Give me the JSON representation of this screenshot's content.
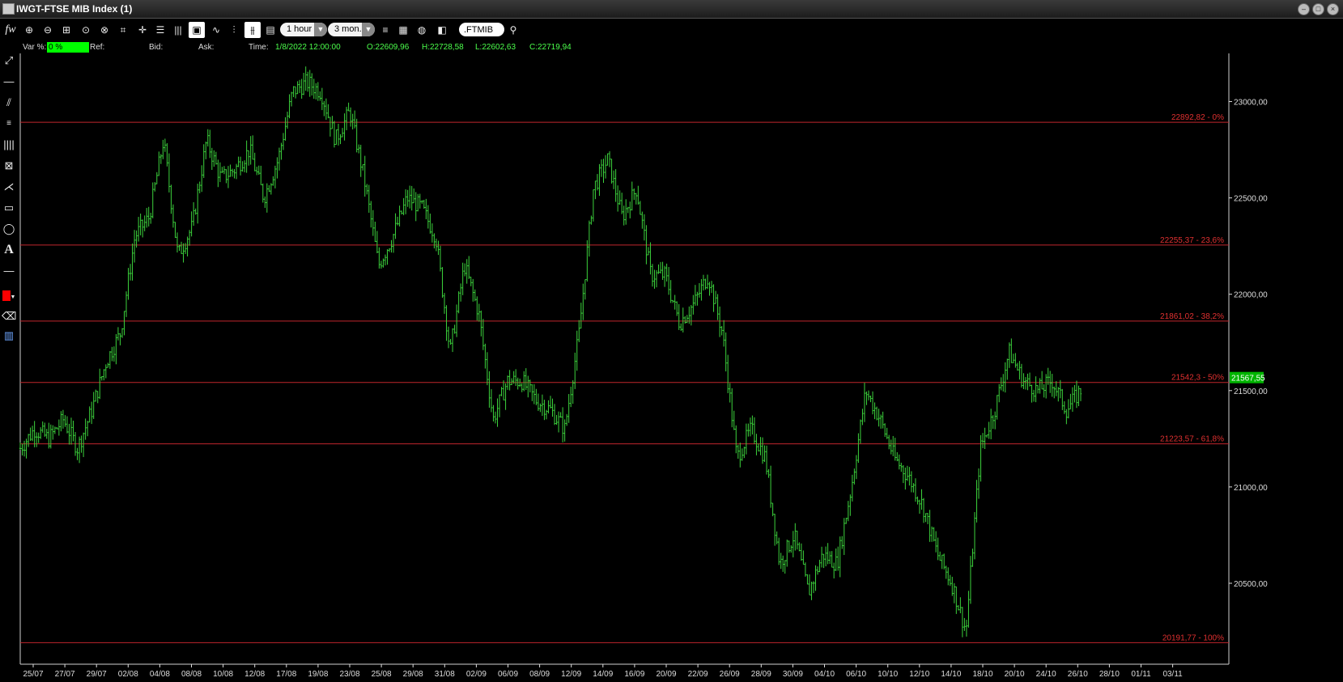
{
  "window": {
    "title": "IWGT-FTSE MIB Index (1)"
  },
  "toolbar": {
    "fx_label": "fw",
    "interval": "1 hour",
    "range": "3 mon..",
    "symbol": ".FTMIB"
  },
  "infobar": {
    "var_label": "Var %:",
    "var_value": "0 %",
    "ref_label": "Ref:",
    "bid_label": "Bid:",
    "ask_label": "Ask:",
    "time_label": "Time:",
    "time_value": "1/8/2022 12:00:00",
    "open": "O:22609,96",
    "high": "H:22728,58",
    "low": "L:22602,63",
    "close": "C:22719,94"
  },
  "colors": {
    "background": "#000000",
    "price": "#3cd23c",
    "fib_line": "#c0262c",
    "fib_text": "#e03030",
    "axis": "#dddddd",
    "price_tag": "#00b400"
  },
  "icons": [
    "draw-line-icon",
    "horizontal-line-icon",
    "channel-icon",
    "fibonacci-icon",
    "vertical-lines-icon",
    "gann-icon",
    "pitchfork-icon",
    "rectangle-icon",
    "ellipse-icon",
    "text-icon",
    "color-swatch-icon",
    "eraser-icon",
    "trash-icon"
  ],
  "chart_data": {
    "type": "bar",
    "subtype": "ohlc-1h",
    "title": "",
    "ylim": [
      20080,
      23250
    ],
    "y_ticks": [
      20500,
      21000,
      21500,
      22000,
      22500,
      23000
    ],
    "y_tick_labels": [
      "20500,00",
      "21000,00",
      "21500,00",
      "22000,00",
      "22500,00",
      "23000,00"
    ],
    "x_tick_labels": [
      "25/07",
      "27/07",
      "29/07",
      "02/08",
      "04/08",
      "08/08",
      "10/08",
      "12/08",
      "17/08",
      "19/08",
      "23/08",
      "25/08",
      "29/08",
      "31/08",
      "02/09",
      "06/09",
      "08/09",
      "12/09",
      "14/09",
      "16/09",
      "20/09",
      "22/09",
      "26/09",
      "28/09",
      "30/09",
      "04/10",
      "06/10",
      "10/10",
      "12/10",
      "14/10",
      "18/10",
      "20/10",
      "24/10",
      "26/10",
      "28/10",
      "01/11",
      "03/11"
    ],
    "last_price": 21567.55,
    "last_price_label": "21567,55",
    "fib_levels": [
      {
        "value": 22892.82,
        "label": "22892,82 - 0%"
      },
      {
        "value": 22255.37,
        "label": "22255,37 - 23,6%"
      },
      {
        "value": 21861.02,
        "label": "21861,02 - 38,2%"
      },
      {
        "value": 21542.3,
        "label": "21542,3 - 50%"
      },
      {
        "value": 21223.57,
        "label": "21223,57 - 61,8%"
      },
      {
        "value": 20191.77,
        "label": "20191,77 - 100%"
      }
    ],
    "price_path": [
      [
        0,
        21200
      ],
      [
        1,
        21300
      ],
      [
        2,
        21250
      ],
      [
        3,
        21350
      ],
      [
        4,
        21200
      ],
      [
        5,
        21400
      ],
      [
        6,
        21650
      ],
      [
        7,
        21800
      ],
      [
        8,
        22300
      ],
      [
        9,
        22400
      ],
      [
        10,
        22800
      ],
      [
        11,
        22200
      ],
      [
        12,
        22350
      ],
      [
        13,
        22800
      ],
      [
        14,
        22600
      ],
      [
        15,
        22650
      ],
      [
        16,
        22750
      ],
      [
        17,
        22500
      ],
      [
        18,
        22700
      ],
      [
        19,
        23050
      ],
      [
        20,
        23100
      ],
      [
        21,
        23050
      ],
      [
        22,
        22800
      ],
      [
        23,
        22950
      ],
      [
        24,
        22600
      ],
      [
        25,
        22150
      ],
      [
        26,
        22300
      ],
      [
        27,
        22500
      ],
      [
        28,
        22450
      ],
      [
        29,
        22300
      ],
      [
        30,
        21700
      ],
      [
        31,
        22150
      ],
      [
        32,
        21900
      ],
      [
        33,
        21350
      ],
      [
        34,
        21550
      ],
      [
        35,
        21550
      ],
      [
        36,
        21450
      ],
      [
        37,
        21400
      ],
      [
        38,
        21300
      ],
      [
        39,
        21800
      ],
      [
        40,
        22550
      ],
      [
        41,
        22700
      ],
      [
        42,
        22400
      ],
      [
        43,
        22550
      ],
      [
        44,
        22100
      ],
      [
        45,
        22100
      ],
      [
        46,
        21850
      ],
      [
        47,
        21950
      ],
      [
        48,
        22100
      ],
      [
        49,
        21800
      ],
      [
        50,
        21150
      ],
      [
        51,
        21300
      ],
      [
        52,
        21150
      ],
      [
        53,
        20600
      ],
      [
        54,
        20750
      ],
      [
        55,
        20450
      ],
      [
        56,
        20650
      ],
      [
        57,
        20600
      ],
      [
        58,
        21000
      ],
      [
        59,
        21500
      ],
      [
        60,
        21350
      ],
      [
        61,
        21150
      ],
      [
        62,
        21050
      ],
      [
        63,
        20900
      ],
      [
        64,
        20650
      ],
      [
        65,
        20500
      ],
      [
        66,
        20250
      ],
      [
        67,
        21200
      ],
      [
        68,
        21400
      ],
      [
        69,
        21700
      ],
      [
        70,
        21550
      ],
      [
        71,
        21500
      ],
      [
        72,
        21550
      ],
      [
        73,
        21400
      ],
      [
        74,
        21500
      ]
    ]
  }
}
